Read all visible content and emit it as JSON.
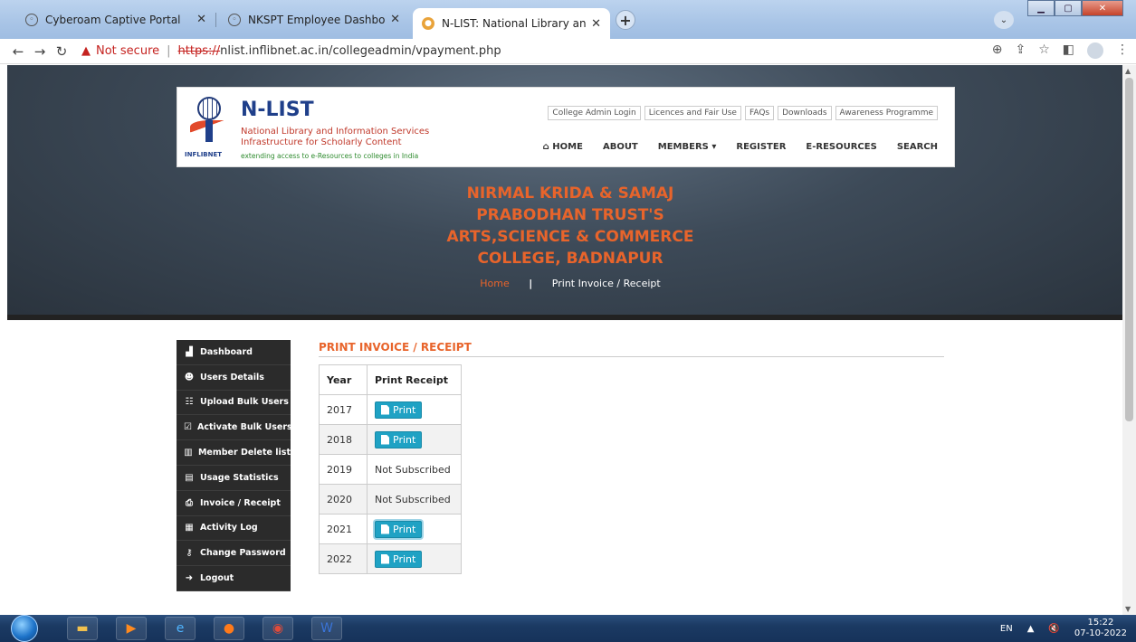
{
  "browser": {
    "tabs": [
      {
        "title": "Cyberoam Captive Portal",
        "active": false
      },
      {
        "title": "NKSPT Employee Dashboard",
        "active": false
      },
      {
        "title": "N-LIST: National Library and Info",
        "active": true
      }
    ],
    "new_tab_icon": "+",
    "window_controls": [
      "minimize",
      "maximize",
      "close"
    ]
  },
  "addressbar": {
    "security_label": "Not secure",
    "url_scheme": "https://",
    "url_rest": "nlist.inflibnet.ac.in/collegeadmin/vpayment.php"
  },
  "header": {
    "brand_title": "N-LIST",
    "brand_line1": "National Library and Information Services",
    "brand_line2": "Infrastructure for Scholarly Content",
    "brand_tagline": "extending access to e-Resources to colleges in India",
    "logo_text": "INFLIBNET",
    "top_links": [
      "College Admin Login",
      "Licences and Fair Use",
      "FAQs",
      "Downloads",
      "Awareness Programme"
    ],
    "nav": [
      "HOME",
      "ABOUT",
      "MEMBERS",
      "REGISTER",
      "E-RESOURCES",
      "SEARCH"
    ]
  },
  "hero": {
    "college_lines": [
      "NIRMAL KRIDA & SAMAJ",
      "PRABODHAN TRUST'S",
      "ARTS,SCIENCE & COMMERCE",
      "COLLEGE, BADNAPUR"
    ],
    "breadcrumb_home": "Home",
    "breadcrumb_sep": "|",
    "breadcrumb_current": "Print Invoice / Receipt"
  },
  "sidebar": {
    "items": [
      {
        "label": "Dashboard",
        "icon": "dashboard-icon"
      },
      {
        "label": "Users Details",
        "icon": "users-icon"
      },
      {
        "label": "Upload Bulk Users",
        "icon": "group-icon"
      },
      {
        "label": "Activate Bulk Users",
        "icon": "checkbox-icon"
      },
      {
        "label": "Member Delete list",
        "icon": "trash-icon"
      },
      {
        "label": "Usage Statistics",
        "icon": "bar-chart-icon"
      },
      {
        "label": "Invoice / Receipt",
        "icon": "printer-icon"
      },
      {
        "label": "Activity Log",
        "icon": "list-icon"
      },
      {
        "label": "Change Password",
        "icon": "key-icon"
      },
      {
        "label": "Logout",
        "icon": "logout-icon"
      }
    ]
  },
  "content": {
    "title": "PRINT INVOICE / RECEIPT",
    "table": {
      "headers": [
        "Year",
        "Print Receipt"
      ],
      "rows": [
        {
          "year": "2017",
          "status": "Print",
          "printable": true
        },
        {
          "year": "2018",
          "status": "Print",
          "printable": true
        },
        {
          "year": "2019",
          "status": "Not Subscribed",
          "printable": false
        },
        {
          "year": "2020",
          "status": "Not Subscribed",
          "printable": false
        },
        {
          "year": "2021",
          "status": "Print",
          "printable": true
        },
        {
          "year": "2022",
          "status": "Print",
          "printable": true
        }
      ]
    }
  },
  "taskbar": {
    "language": "EN",
    "time": "15:22",
    "date": "07-10-2022"
  },
  "colors": {
    "accent_orange": "#e8642b",
    "brand_blue": "#1f3f8a",
    "print_button": "#1fa2c4",
    "sidebar_bg": "#2b2b2b"
  }
}
